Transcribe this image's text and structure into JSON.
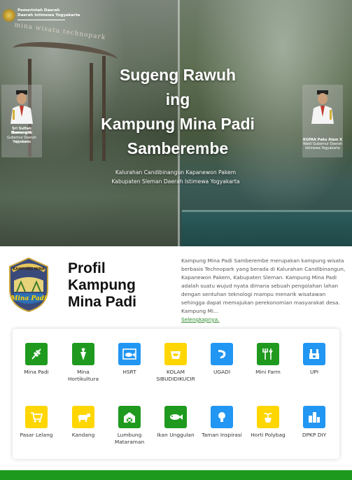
{
  "header": {
    "gov_line1": "Pemerintah Daerah",
    "gov_line2": "Daerah Istimewa Yogyakarta"
  },
  "hero": {
    "arch_text": "mina wisata technopark",
    "title_lines": [
      "Sugeng Rawuh",
      "ing",
      "Kampung Mina Padi",
      "Samberembe"
    ],
    "subtitle_line1": "Kalurahan Candibinangun Kapanewon Pakem",
    "subtitle_line2": "Kabupaten Sleman Daerah Istimewa Yogyakarta",
    "official_left": {
      "name1": "Sri Sultan Hamengku",
      "name2": "Buwono X",
      "role1": "Gubernur Daerah Istimewa",
      "role2": "Yogyakarta"
    },
    "official_right": {
      "name1": "KGPAA Paku Alam X",
      "role1": "Wakil Gubernur Daerah",
      "role2": "Istimewa Yogyakarta"
    }
  },
  "profile": {
    "logo_top": "KAMPUNG MINA",
    "logo_text": "Mina Padi",
    "title_lines": [
      "Profil",
      "Kampung",
      "Mina Padi"
    ],
    "description": "Kampung Mina Padi Samberembe merupakan kampung wisata berbasis Technopark yang berada di Kalurahan Candibinangun, Kapanewon Pakem, Kabupaten Sleman. Kampung Mina Padi adalah suatu wujud nyata dimana sebuah pengolahan lahan dengan sentuhan teknologi mampu menarik wisatawan sehingga dapat memajukan perekonomian masyarakat desa. Kampung Mi...",
    "read_more": "Selengkapnya."
  },
  "menu": [
    {
      "label": "Mina Padi",
      "icon": "rice-plant-icon",
      "color": "#1f9a1f"
    },
    {
      "label": "Mina Hortikultura",
      "icon": "carrot-icon",
      "color": "#1f9a1f"
    },
    {
      "label": "HSRT",
      "icon": "fish-icon",
      "color": "#2196f3"
    },
    {
      "label": "KOLAM SIBUDIDIKUCIR",
      "icon": "fish-bowl-icon",
      "color": "#ffd600"
    },
    {
      "label": "UGADI",
      "icon": "shrimp-icon",
      "color": "#2196f3"
    },
    {
      "label": "Mini Farm",
      "icon": "garden-tools-icon",
      "color": "#1f9a1f"
    },
    {
      "label": "UPI",
      "icon": "factory-icon",
      "color": "#2196f3"
    },
    {
      "label": "Pasar Lelang",
      "icon": "cart-icon",
      "color": "#ffd600"
    },
    {
      "label": "Kandang",
      "icon": "cow-icon",
      "color": "#ffd600"
    },
    {
      "label": "Lumbung Mataraman",
      "icon": "barn-icon",
      "color": "#1f9a1f"
    },
    {
      "label": "Ikan Unggulan",
      "icon": "fish-icon",
      "color": "#1f9a1f"
    },
    {
      "label": "Taman Inspirasi",
      "icon": "lightbulb-icon",
      "color": "#2196f3"
    },
    {
      "label": "Horti Polybag",
      "icon": "potted-plant-icon",
      "color": "#ffd600"
    },
    {
      "label": "DPKP DIY",
      "icon": "city-icon",
      "color": "#2196f3"
    }
  ]
}
